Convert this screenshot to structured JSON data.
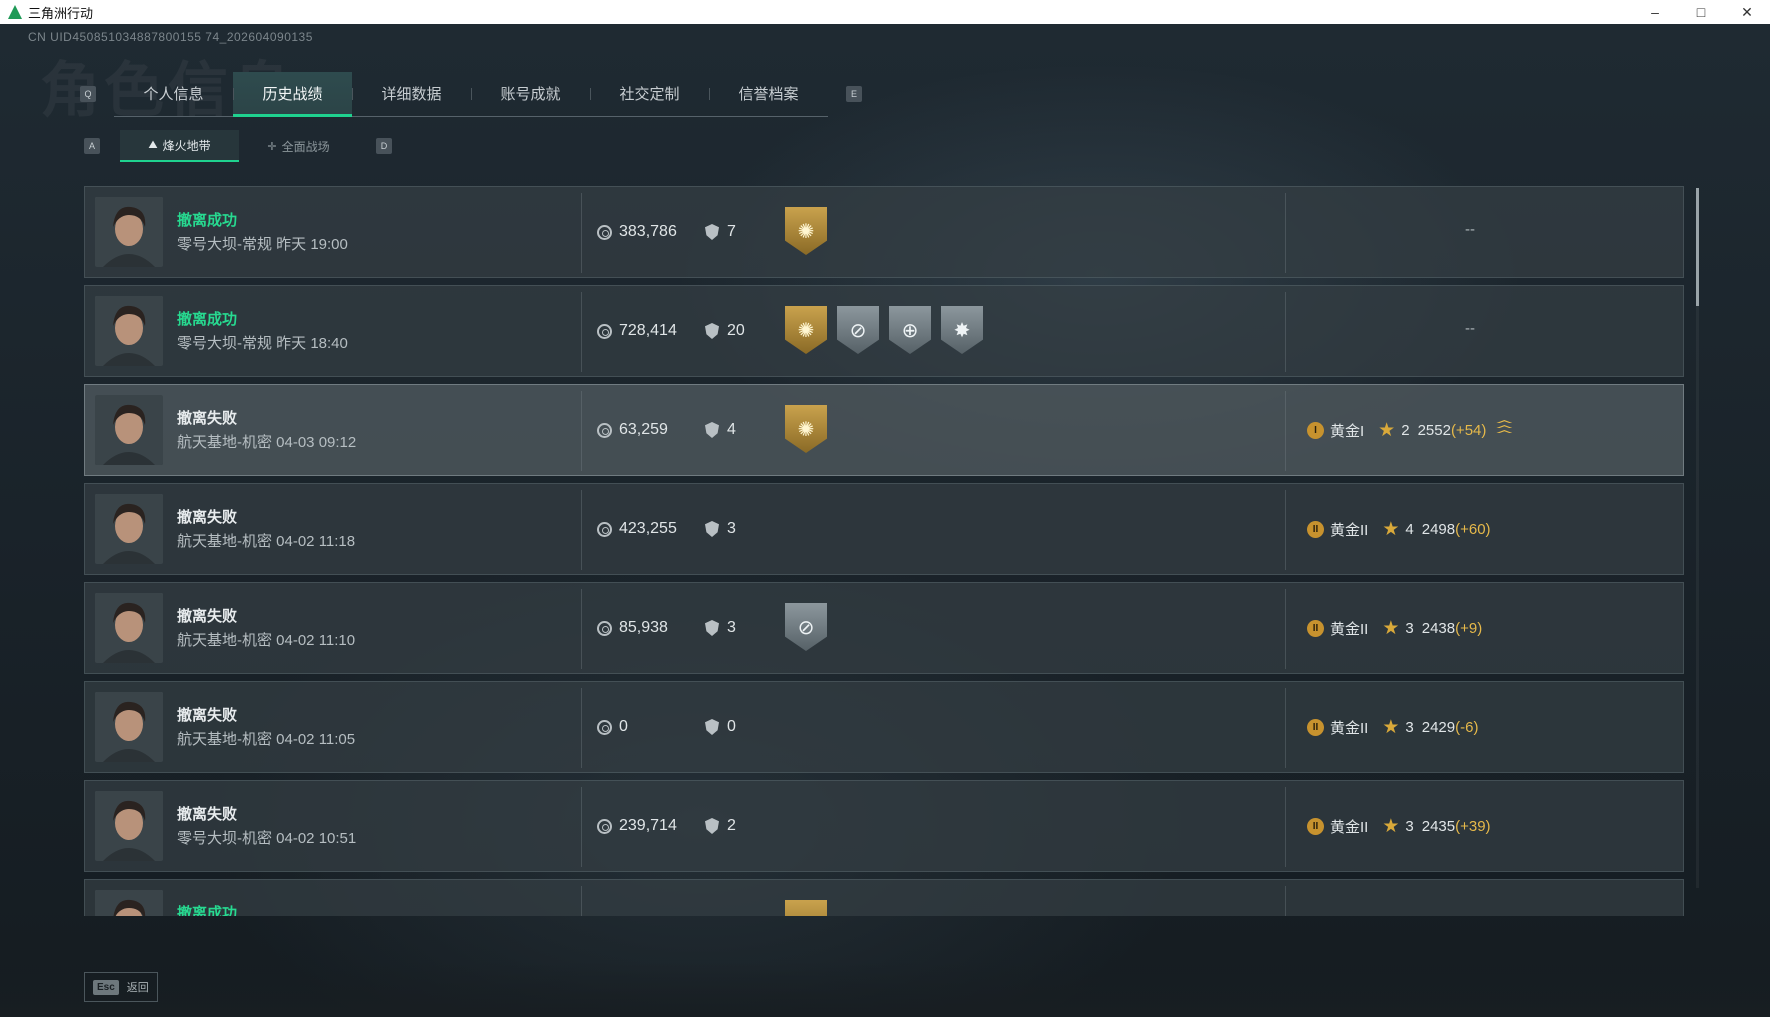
{
  "window": {
    "title": "三角洲行动",
    "minimize": "–",
    "maximize": "□",
    "close": "✕"
  },
  "header": {
    "uid": "CN UID450851034887800155 74_202604090135",
    "background_title": "角色信息"
  },
  "tabs": {
    "prev_key": "Q",
    "next_key": "E",
    "items": [
      {
        "label": "个人信息"
      },
      {
        "label": "历史战绩"
      },
      {
        "label": "详细数据"
      },
      {
        "label": "账号成就"
      },
      {
        "label": "社交定制"
      },
      {
        "label": "信誉档案"
      }
    ],
    "active_index": 1
  },
  "subtabs": {
    "prev_key": "A",
    "next_key": "D",
    "items": [
      {
        "label": "烽火地带",
        "icon": "mountain-icon",
        "glyph": "⛰"
      },
      {
        "label": "全面战场",
        "icon": "crosshair-icon",
        "glyph": "✛"
      }
    ],
    "active_index": 0
  },
  "matches": [
    {
      "status": "撤离成功",
      "result": "success",
      "detail": "零号大坝-常规 昨天 19:00",
      "value": "383,786",
      "kills": "7",
      "badges": [
        {
          "icon": "gold-sun-badge-icon",
          "tone": "gold",
          "glyph": "✺"
        }
      ],
      "rank": null,
      "rank_empty": "--"
    },
    {
      "status": "撤离成功",
      "result": "success",
      "detail": "零号大坝-常规 昨天 18:40",
      "value": "728,414",
      "kills": "20",
      "badges": [
        {
          "icon": "gold-sun-badge-icon",
          "tone": "gold",
          "glyph": "✺"
        },
        {
          "icon": "crosshair-badge-icon",
          "tone": "silver",
          "glyph": "⊘"
        },
        {
          "icon": "target-badge-icon",
          "tone": "silver",
          "glyph": "⊕"
        },
        {
          "icon": "burst-badge-icon",
          "tone": "silver",
          "glyph": "✸"
        }
      ],
      "rank": null,
      "rank_empty": "--"
    },
    {
      "status": "撤离失败",
      "result": "fail",
      "detail": "航天基地-机密 04-03 09:12",
      "value": "63,259",
      "kills": "4",
      "badges": [
        {
          "icon": "gold-sun-badge-icon",
          "tone": "gold",
          "glyph": "✺"
        }
      ],
      "rank": {
        "tier_numeral": "I",
        "tier": "黄金I",
        "stars": "2",
        "score": "2552",
        "delta": "(+54)",
        "rank_up": true
      },
      "highlight": true
    },
    {
      "status": "撤离失败",
      "result": "fail",
      "detail": "航天基地-机密 04-02 11:18",
      "value": "423,255",
      "kills": "3",
      "badges": [],
      "rank": {
        "tier_numeral": "II",
        "tier": "黄金II",
        "stars": "4",
        "score": "2498",
        "delta": "(+60)",
        "rank_up": false
      }
    },
    {
      "status": "撤离失败",
      "result": "fail",
      "detail": "航天基地-机密 04-02 11:10",
      "value": "85,938",
      "kills": "3",
      "badges": [
        {
          "icon": "crosshair-badge-icon",
          "tone": "silver",
          "glyph": "⊘"
        }
      ],
      "rank": {
        "tier_numeral": "II",
        "tier": "黄金II",
        "stars": "3",
        "score": "2438",
        "delta": "(+9)",
        "rank_up": false
      }
    },
    {
      "status": "撤离失败",
      "result": "fail",
      "detail": "航天基地-机密 04-02 11:05",
      "value": "0",
      "kills": "0",
      "badges": [],
      "rank": {
        "tier_numeral": "II",
        "tier": "黄金II",
        "stars": "3",
        "score": "2429",
        "delta": "(-6)",
        "rank_up": false
      }
    },
    {
      "status": "撤离失败",
      "result": "fail",
      "detail": "零号大坝-机密 04-02 10:51",
      "value": "239,714",
      "kills": "2",
      "badges": [],
      "rank": {
        "tier_numeral": "II",
        "tier": "黄金II",
        "stars": "3",
        "score": "2435",
        "delta": "(+39)",
        "rank_up": false
      }
    },
    {
      "status": "撤离成功",
      "result": "success",
      "detail": "",
      "value": "",
      "kills": "",
      "badges": [
        {
          "icon": "gold-sun-badge-icon",
          "tone": "gold",
          "glyph": "✺"
        }
      ],
      "rank": null,
      "rank_empty": ""
    }
  ],
  "footer": {
    "esc_key": "Esc",
    "esc_label": "返回"
  },
  "colors": {
    "accent": "#1fd28f",
    "success_text": "#27d990",
    "gold": "#e6b94a"
  }
}
